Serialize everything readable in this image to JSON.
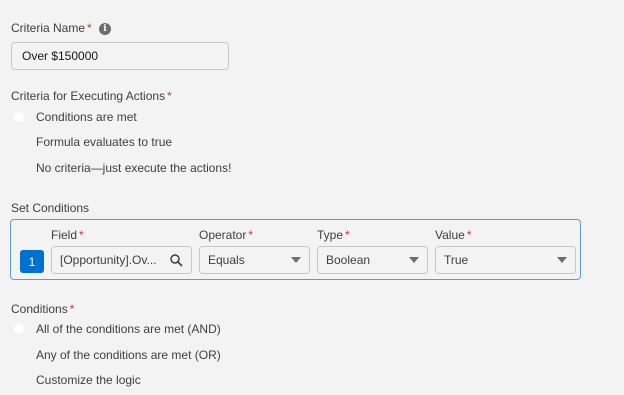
{
  "criteria_name": {
    "label": "Criteria Name",
    "required_mark": "*",
    "info_icon": "info-icon",
    "value": "Over $150000"
  },
  "executing_actions": {
    "label": "Criteria for Executing Actions",
    "required_mark": "*",
    "options": [
      "Conditions are met",
      "Formula evaluates to true",
      "No criteria—just execute the actions!"
    ]
  },
  "set_conditions": {
    "label": "Set Conditions",
    "row_number": "1",
    "field": {
      "label": "Field",
      "required_mark": "*",
      "value": "[Opportunity].Ov...",
      "icon": "search-icon"
    },
    "operator": {
      "label": "Operator",
      "required_mark": "*",
      "value": "Equals"
    },
    "type": {
      "label": "Type",
      "required_mark": "*",
      "value": "Boolean"
    },
    "value": {
      "label": "Value",
      "required_mark": "*",
      "value": "True"
    }
  },
  "conditions": {
    "label": "Conditions",
    "required_mark": "*",
    "options": [
      "All of the conditions are met (AND)",
      "Any of the conditions are met (OR)",
      "Customize the logic"
    ]
  },
  "colors": {
    "required": "#c23934",
    "accent": "#0070d2",
    "box_border": "#5a9bd5",
    "background": "#f3f3f3"
  }
}
